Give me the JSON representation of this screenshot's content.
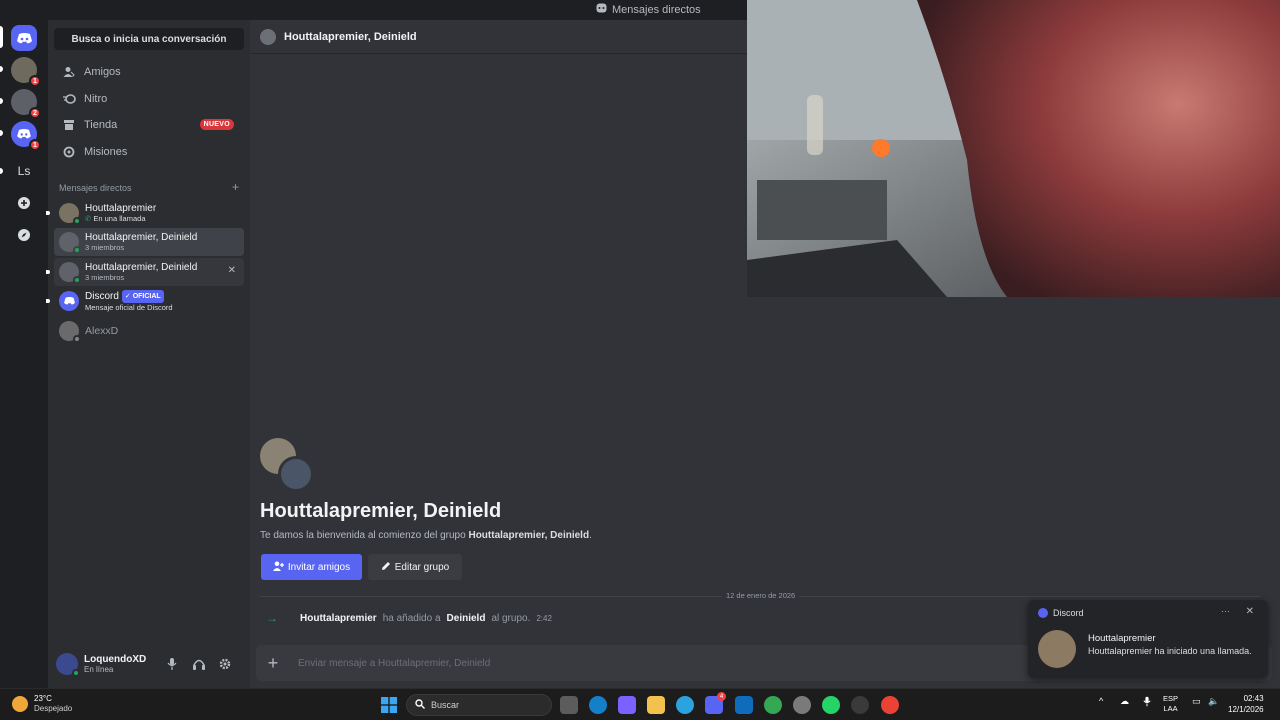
{
  "topbar": {
    "title": "Mensajes directos"
  },
  "rail": {
    "badges": [
      "1",
      "2",
      "1"
    ],
    "ls_label": "Ls"
  },
  "sidebar": {
    "search_label": "Busca o inicia una conversación",
    "nav": [
      {
        "label": "Amigos",
        "icon": "friends-icon"
      },
      {
        "label": "Nitro",
        "icon": "nitro-icon"
      },
      {
        "label": "Tienda",
        "icon": "store-icon",
        "badge": "NUEVO"
      },
      {
        "label": "Misiones",
        "icon": "quests-icon"
      }
    ],
    "dm_header": "Mensajes directos",
    "dm_add": "+",
    "dms": [
      {
        "name": "Houttalapremier",
        "sub": "En una llamada"
      },
      {
        "name": "Houttalapremier, Deinield",
        "sub": "3 miembros"
      },
      {
        "name": "Houttalapremier, Deinield",
        "sub": "3 miembros"
      },
      {
        "name": "Discord",
        "badge": "✓ OFICIAL",
        "sub": "Mensaje oficial de Discord"
      },
      {
        "name": "AlexxD",
        "sub": ""
      }
    ]
  },
  "user": {
    "name": "LoquendoXD",
    "status": "En línea"
  },
  "main": {
    "header_title": "Houttalapremier, Deinield",
    "welcome_title": "Houttalapremier, Deinield",
    "welcome_prefix": "Te damos la bienvenida al comienzo del grupo",
    "welcome_group": "Houttalapremier, Deinield",
    "welcome_suffix": ".",
    "invite_label": "Invitar amigos",
    "edit_label": "Editar grupo",
    "date": "12 de enero de 2026",
    "sys_user": "Houttalapremier",
    "sys_mid": "ha añadido a",
    "sys_target": "Deinield",
    "sys_end": "al grupo.",
    "sys_time": "2:42",
    "input_placeholder": "Enviar mensaje a Houttalapremier, Deinield"
  },
  "toast": {
    "app": "Discord",
    "more": "···",
    "title": "Houttalapremier",
    "body": "Houttalapremier ha iniciado una llamada."
  },
  "taskbar": {
    "temp": "23°C",
    "weather": "Despejado",
    "search": "Buscar",
    "lang1": "ESP",
    "lang2": "LAA",
    "time": "02:43",
    "date": "12/1/2026",
    "discord_badge": "4"
  }
}
